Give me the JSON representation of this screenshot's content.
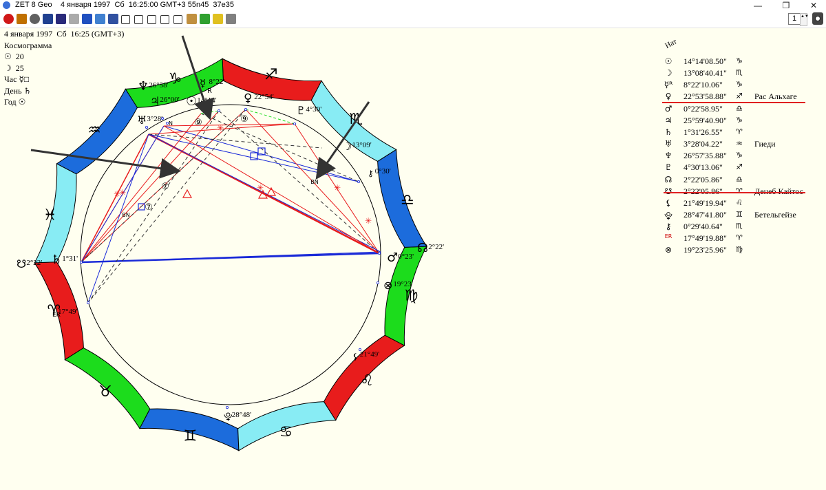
{
  "window": {
    "title": "ZET 8 Geo    4 января 1997  Сб  16:25:00 GMT+3 55n45  37e35",
    "minimize": "—",
    "restore": "❐",
    "close": "✕"
  },
  "toolbar": {
    "spin_value": "1",
    "spin_arrows": "▲▼"
  },
  "left_info": [
    "4 января 1997  Сб  16:25 (GMT+3)",
    "Космограмма",
    "☉  20",
    "☽  25",
    "Час ☿□",
    "День ♄",
    "Год ☉"
  ],
  "table_header": "Нат",
  "planets": [
    {
      "glyph": "☉",
      "value": "14°14'08.50\"",
      "sign": "♑",
      "star": ""
    },
    {
      "glyph": "☽",
      "value": "13°08'40.41\"",
      "sign": "♏",
      "star": ""
    },
    {
      "glyph": "☿ᴿ",
      "value": "8°22'10.06\"",
      "sign": "♑",
      "star": ""
    },
    {
      "glyph": "♀",
      "value": "22°53'58.88\"",
      "sign": "♐",
      "star": "Рас Альхаге"
    },
    {
      "glyph": "♂",
      "value": "0°22'58.95\"",
      "sign": "♎",
      "star": ""
    },
    {
      "glyph": "♃",
      "value": "25°59'40.90\"",
      "sign": "♑",
      "star": ""
    },
    {
      "glyph": "♄",
      "value": "1°31'26.55\"",
      "sign": "♈",
      "star": ""
    },
    {
      "glyph": "♅",
      "value": "3°28'04.22\"",
      "sign": "♒",
      "star": "Гиеди"
    },
    {
      "glyph": "♆",
      "value": "26°57'35.88\"",
      "sign": "♑",
      "star": ""
    },
    {
      "glyph": "♇",
      "value": "4°30'13.06\"",
      "sign": "♐",
      "star": ""
    },
    {
      "glyph": "☊",
      "value": "2°22'05.86\"",
      "sign": "♎",
      "star": ""
    },
    {
      "glyph": "☋",
      "value": "2°22'05.86\"",
      "sign": "♈",
      "star": "Денеб Кайтос"
    },
    {
      "glyph": "⚸",
      "value": "21°49'19.94\"",
      "sign": "♌",
      "star": ""
    },
    {
      "glyph": "⯓",
      "value": "28°47'41.80\"",
      "sign": "♊",
      "star": "Бетельгейзе"
    },
    {
      "glyph": "⚷",
      "value": "0°29'40.64\"",
      "sign": "♏",
      "star": ""
    },
    {
      "glyph": "ER",
      "value": "17°49'19.88\"",
      "sign": "♈",
      "star": ""
    },
    {
      "glyph": "⊗",
      "value": "19°23'25.96\"",
      "sign": "♍",
      "star": ""
    }
  ],
  "zodiac": [
    "♈",
    "♉",
    "♊",
    "♋",
    "♌",
    "♍",
    "♎",
    "♏",
    "♐",
    "♑",
    "♒",
    "♓"
  ],
  "zodiac_colors": [
    "#e81c1c",
    "#1cdc1c",
    "#1c6cdc",
    "#88ecf4"
  ],
  "chart_labels": [
    {
      "text": "♆",
      "deg": "26°58'"
    },
    {
      "text": "♃",
      "deg": "26°00'"
    },
    {
      "text": "☉",
      "deg": "14°14'"
    },
    {
      "text": "☿",
      "deg": "8°22'"
    },
    {
      "text": "R",
      "deg": ""
    },
    {
      "text": "♀",
      "deg": "22°54'"
    },
    {
      "text": "♇",
      "deg": "4°30'"
    },
    {
      "text": "☽",
      "deg": "13°09'"
    },
    {
      "text": "⚷",
      "deg": "0°30'"
    },
    {
      "text": "☊",
      "deg": "2°22'"
    },
    {
      "text": "♂",
      "deg": "0°23'"
    },
    {
      "text": "⊗",
      "deg": "19°23'"
    },
    {
      "text": "⚸",
      "deg": "21°49'"
    },
    {
      "text": "⯓",
      "deg": "28°48'"
    },
    {
      "text": "ER",
      "deg": "17°49'"
    },
    {
      "text": "♄",
      "deg": "1°31'"
    },
    {
      "text": "☋",
      "deg": "2°22'"
    },
    {
      "text": "♅",
      "deg": "3°28'"
    }
  ],
  "aspect_marks": {
    "septile": "⑦",
    "novile": "⑨",
    "bn": "BN",
    "n": "N"
  }
}
